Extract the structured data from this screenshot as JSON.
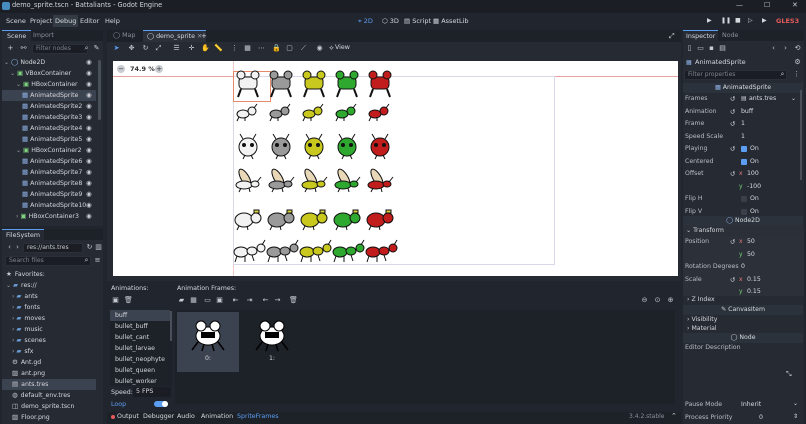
{
  "window": {
    "title": "demo_sprite.tscn - Battaliants - Godot Engine",
    "icon": "godot-icon",
    "controls": [
      "minimize-icon",
      "maximize-icon",
      "close-icon"
    ]
  },
  "menu": [
    "Scene",
    "Project",
    "Debug",
    "Editor",
    "Help"
  ],
  "workspaces": [
    "2D",
    "3D",
    "Script",
    "AssetLib"
  ],
  "renderer": "GLES3",
  "scene_dock": {
    "tabs": [
      "Scene",
      "Import"
    ],
    "filter_placeholder": "Filter nodes",
    "tree": [
      {
        "label": "Node2D",
        "indent": 0,
        "icon": "node2d-icon",
        "arrow": "v"
      },
      {
        "label": "VBoxContainer",
        "indent": 1,
        "icon": "container-icon",
        "arrow": "v"
      },
      {
        "label": "HBoxContainer",
        "indent": 2,
        "icon": "container-icon",
        "arrow": "v"
      },
      {
        "label": "AnimatedSprite",
        "indent": 3,
        "icon": "sprite-icon",
        "arrow": "",
        "selected": true
      },
      {
        "label": "AnimatedSprite2",
        "indent": 3,
        "icon": "sprite-icon",
        "arrow": ""
      },
      {
        "label": "AnimatedSprite3",
        "indent": 3,
        "icon": "sprite-icon",
        "arrow": ""
      },
      {
        "label": "AnimatedSprite4",
        "indent": 3,
        "icon": "sprite-icon",
        "arrow": ""
      },
      {
        "label": "AnimatedSprite5",
        "indent": 3,
        "icon": "sprite-icon",
        "arrow": ""
      },
      {
        "label": "HBoxContainer2",
        "indent": 2,
        "icon": "container-icon",
        "arrow": "v"
      },
      {
        "label": "AnimatedSprite6",
        "indent": 3,
        "icon": "sprite-icon",
        "arrow": ""
      },
      {
        "label": "AnimatedSprite7",
        "indent": 3,
        "icon": "sprite-icon",
        "arrow": ""
      },
      {
        "label": "AnimatedSprite8",
        "indent": 3,
        "icon": "sprite-icon",
        "arrow": ""
      },
      {
        "label": "AnimatedSprite9",
        "indent": 3,
        "icon": "sprite-icon",
        "arrow": ""
      },
      {
        "label": "AnimatedSprite10",
        "indent": 3,
        "icon": "sprite-icon",
        "arrow": ""
      },
      {
        "label": "HBoxContainer3",
        "indent": 2,
        "icon": "container-icon",
        "arrow": ">"
      }
    ]
  },
  "filesystem": {
    "title": "FileSystem",
    "path": "res://ants.tres",
    "search_placeholder": "Search files",
    "items": [
      {
        "label": "Favorites:",
        "indent": 0,
        "icon": "star-icon"
      },
      {
        "label": "res://",
        "indent": 0,
        "icon": "folder-icon",
        "arrow": "v"
      },
      {
        "label": "ants",
        "indent": 1,
        "icon": "folder-icon",
        "arrow": ">"
      },
      {
        "label": "fonts",
        "indent": 1,
        "icon": "folder-icon",
        "arrow": ">"
      },
      {
        "label": "moves",
        "indent": 1,
        "icon": "folder-icon",
        "arrow": ">"
      },
      {
        "label": "music",
        "indent": 1,
        "icon": "folder-icon",
        "arrow": ">"
      },
      {
        "label": "scenes",
        "indent": 1,
        "icon": "folder-icon",
        "arrow": ">"
      },
      {
        "label": "sfx",
        "indent": 1,
        "icon": "folder-icon",
        "arrow": ">"
      },
      {
        "label": "Ant.gd",
        "indent": 1,
        "icon": "gear-icon"
      },
      {
        "label": "ant.png",
        "indent": 1,
        "icon": "image-icon"
      },
      {
        "label": "ants.tres",
        "indent": 1,
        "icon": "resource-icon",
        "selected": true
      },
      {
        "label": "default_env.tres",
        "indent": 1,
        "icon": "globe-icon"
      },
      {
        "label": "demo_sprite.tscn",
        "indent": 1,
        "icon": "scene-icon"
      },
      {
        "label": "Floor.png",
        "indent": 1,
        "icon": "image-icon"
      }
    ]
  },
  "editor_tabs": {
    "tabs": [
      {
        "label": "Map",
        "active": false
      },
      {
        "label": "demo_sprite",
        "active": true
      }
    ]
  },
  "toolbar2d": {
    "view_label": "View"
  },
  "viewport": {
    "zoom": "74.9 %",
    "ants": [
      {
        "row": 0,
        "colors": [
          "#f2f2f2",
          "#9a9a9a",
          "#c8c81e",
          "#2ea82e",
          "#c21d1d"
        ],
        "kind": "buff"
      },
      {
        "row": 1,
        "colors": [
          "#f2f2f2",
          "#9a9a9a",
          "#c8c81e",
          "#2ea82e",
          "#c21d1d"
        ],
        "kind": "small"
      },
      {
        "row": 2,
        "colors": [
          "#f2f2f2",
          "#9a9a9a",
          "#c8c81e",
          "#2ea82e",
          "#c21d1d"
        ],
        "kind": "head"
      },
      {
        "row": 3,
        "colors": [
          "#f2f2f2",
          "#9a9a9a",
          "#c8c81e",
          "#2ea82e",
          "#c21d1d"
        ],
        "kind": "winged"
      },
      {
        "row": 4,
        "colors": [
          "#f2f2f2",
          "#9a9a9a",
          "#c8c81e",
          "#2ea82e",
          "#c21d1d"
        ],
        "kind": "round"
      },
      {
        "row": 5,
        "colors": [
          "#f2f2f2",
          "#9a9a9a",
          "#c8c81e",
          "#2ea82e",
          "#c21d1d"
        ],
        "kind": "long"
      }
    ]
  },
  "spriteframes": {
    "animations_label": "Animations:",
    "frames_label": "Animation Frames:",
    "animations": [
      "buff",
      "bullet_buff",
      "bullet_cant",
      "bullet_larvae",
      "bullet_neophyte",
      "bullet_queen",
      "bullet_worker"
    ],
    "selected_animation": "buff",
    "speed_label": "Speed:",
    "speed_value": "5 FPS",
    "loop_label": "Loop",
    "loop_on": true,
    "frames": [
      {
        "label": "0:",
        "selected": true
      },
      {
        "label": "1:",
        "selected": false
      }
    ]
  },
  "bottom_bar": {
    "tabs": [
      "Output",
      "Debugger",
      "Audio",
      "Animation",
      "SpriteFrames"
    ],
    "active": "SpriteFrames",
    "version": "3.4.2.stable"
  },
  "inspector": {
    "tabs": [
      "Inspector",
      "Node"
    ],
    "node_name": "AnimatedSprite",
    "filter_placeholder": "Filter properties",
    "class_header": "AnimatedSprite",
    "properties": [
      {
        "label": "Frames",
        "value": "ants.tres",
        "revert": true,
        "kind": "resource"
      },
      {
        "label": "Animation",
        "value": "buff",
        "revert": true
      },
      {
        "label": "Frame",
        "value": "1",
        "revert": true
      },
      {
        "label": "Speed Scale",
        "value": "1"
      },
      {
        "label": "Playing",
        "value": "On",
        "revert": true,
        "kind": "check",
        "checked": true
      },
      {
        "label": "Centered",
        "value": "On",
        "kind": "check",
        "checked": true
      },
      {
        "label": "Offset",
        "value": "100",
        "revert": true,
        "axis": "x"
      },
      {
        "label": "",
        "value": "-100",
        "axis": "y"
      },
      {
        "label": "Flip H",
        "value": "On",
        "kind": "check",
        "checked": false
      },
      {
        "label": "Flip V",
        "value": "On",
        "kind": "check",
        "checked": false
      }
    ],
    "node2d_header": "Node2D",
    "transform_label": "Transform",
    "transform": [
      {
        "label": "Position",
        "value": "50",
        "revert": true,
        "axis": "x"
      },
      {
        "label": "",
        "value": "50",
        "axis": "y"
      },
      {
        "label": "Rotation Degrees",
        "value": "0"
      },
      {
        "label": "Scale",
        "value": "0.15",
        "revert": true,
        "axis": "x"
      },
      {
        "label": "",
        "value": "0.15",
        "axis": "y"
      }
    ],
    "zindex_label": "Z Index",
    "canvasitem_header": "CanvasItem",
    "visibility_label": "Visibility",
    "material_label": "Material",
    "node_header": "Node",
    "editor_description_label": "Editor Description",
    "pause_mode_label": "Pause Mode",
    "pause_mode_value": "Inherit",
    "process_priority_label": "Process Priority",
    "process_priority_value": "0"
  },
  "colors": {
    "accent": "#5d9ef5",
    "panel": "#262b33",
    "dark": "#1d2128",
    "viewport_bg": "#ffffff"
  }
}
